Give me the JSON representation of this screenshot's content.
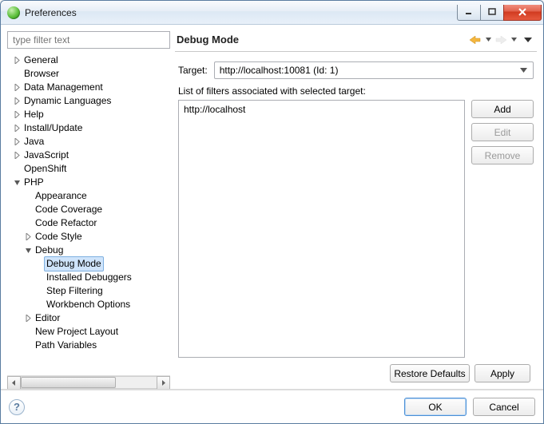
{
  "window": {
    "title": "Preferences"
  },
  "filter": {
    "placeholder": "type filter text"
  },
  "tree": [
    {
      "label": "General",
      "depth": 0,
      "twisty": "closed"
    },
    {
      "label": "Browser",
      "depth": 0,
      "twisty": "none"
    },
    {
      "label": "Data Management",
      "depth": 0,
      "twisty": "closed"
    },
    {
      "label": "Dynamic Languages",
      "depth": 0,
      "twisty": "closed"
    },
    {
      "label": "Help",
      "depth": 0,
      "twisty": "closed"
    },
    {
      "label": "Install/Update",
      "depth": 0,
      "twisty": "closed"
    },
    {
      "label": "Java",
      "depth": 0,
      "twisty": "closed"
    },
    {
      "label": "JavaScript",
      "depth": 0,
      "twisty": "closed"
    },
    {
      "label": "OpenShift",
      "depth": 0,
      "twisty": "none"
    },
    {
      "label": "PHP",
      "depth": 0,
      "twisty": "open"
    },
    {
      "label": "Appearance",
      "depth": 1,
      "twisty": "none"
    },
    {
      "label": "Code Coverage",
      "depth": 1,
      "twisty": "none"
    },
    {
      "label": "Code Refactor",
      "depth": 1,
      "twisty": "none"
    },
    {
      "label": "Code Style",
      "depth": 1,
      "twisty": "closed"
    },
    {
      "label": "Debug",
      "depth": 1,
      "twisty": "open"
    },
    {
      "label": "Debug Mode",
      "depth": 2,
      "twisty": "none",
      "selected": true
    },
    {
      "label": "Installed Debuggers",
      "depth": 2,
      "twisty": "none"
    },
    {
      "label": "Step Filtering",
      "depth": 2,
      "twisty": "none"
    },
    {
      "label": "Workbench Options",
      "depth": 2,
      "twisty": "none"
    },
    {
      "label": "Editor",
      "depth": 1,
      "twisty": "closed"
    },
    {
      "label": "New Project Layout",
      "depth": 1,
      "twisty": "none"
    },
    {
      "label": "Path Variables",
      "depth": 1,
      "twisty": "none"
    }
  ],
  "page": {
    "title": "Debug Mode",
    "target_label": "Target:",
    "target_value": "http://localhost:10081 (Id: 1)",
    "filters_label": "List of filters associated with selected target:",
    "filters": [
      "http://localhost"
    ],
    "buttons": {
      "add": "Add",
      "edit": "Edit",
      "remove": "Remove",
      "restore_defaults": "Restore Defaults",
      "apply": "Apply"
    }
  },
  "footer": {
    "ok": "OK",
    "cancel": "Cancel"
  }
}
